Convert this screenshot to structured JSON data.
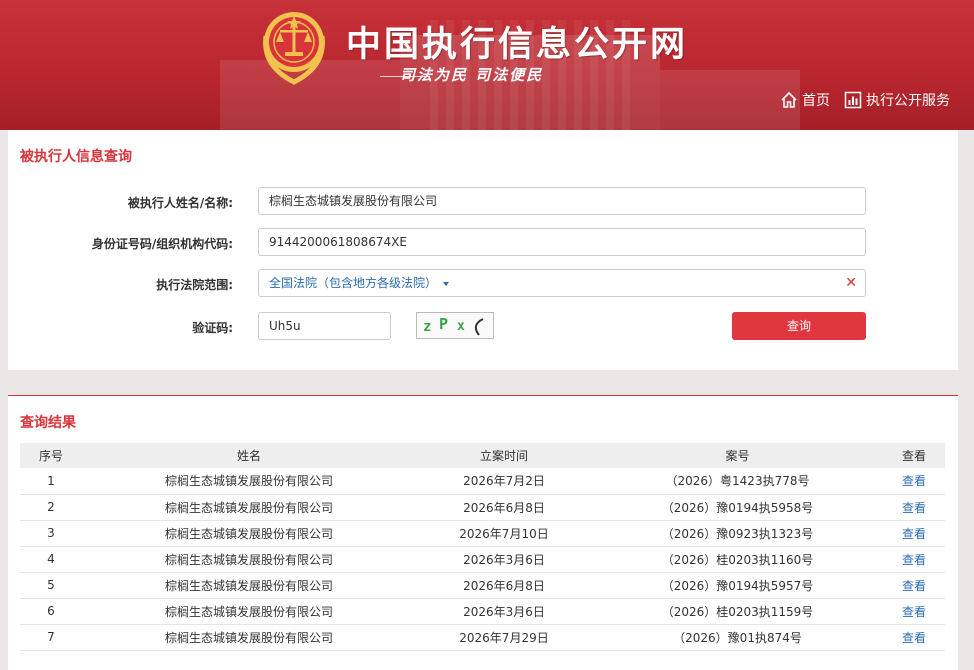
{
  "header": {
    "site_title": "中国执行信息公开网",
    "slogan": "司法为民  司法便民",
    "nav": [
      {
        "label": "首页",
        "icon": "home-icon"
      },
      {
        "label": "执行公开服务",
        "icon": "chart-icon"
      }
    ]
  },
  "search_panel": {
    "title": "被执行人信息查询",
    "fields": {
      "name": {
        "label": "被执行人姓名/名称:",
        "value": "棕榈生态城镇发展股份有限公司"
      },
      "id_code": {
        "label": "身份证号码/组织机构代码:",
        "value": "9144200061808674XE"
      },
      "court": {
        "label": "执行法院范围:",
        "value": "全国法院（包含地方各级法院）"
      },
      "captcha": {
        "label": "验证码:",
        "value": "Uh5u",
        "image_text": "zPxC"
      }
    },
    "query_button": "查询"
  },
  "results_panel": {
    "title": "查询结果",
    "columns": [
      "序号",
      "姓名",
      "立案时间",
      "案号",
      "查看"
    ],
    "rows": [
      {
        "no": "1",
        "name": "棕榈生态城镇发展股份有限公司",
        "date": "2026年7月2日",
        "case": "（2026）粤1423执778号",
        "view": "查看"
      },
      {
        "no": "2",
        "name": "棕榈生态城镇发展股份有限公司",
        "date": "2026年6月8日",
        "case": "（2026）豫0194执5958号",
        "view": "查看"
      },
      {
        "no": "3",
        "name": "棕榈生态城镇发展股份有限公司",
        "date": "2026年7月10日",
        "case": "（2026）豫0923执1323号",
        "view": "查看"
      },
      {
        "no": "4",
        "name": "棕榈生态城镇发展股份有限公司",
        "date": "2026年3月6日",
        "case": "（2026）桂0203执1160号",
        "view": "查看"
      },
      {
        "no": "5",
        "name": "棕榈生态城镇发展股份有限公司",
        "date": "2026年6月8日",
        "case": "（2026）豫0194执5957号",
        "view": "查看"
      },
      {
        "no": "6",
        "name": "棕榈生态城镇发展股份有限公司",
        "date": "2026年3月6日",
        "case": "（2026）桂0203执1159号",
        "view": "查看"
      },
      {
        "no": "7",
        "name": "棕榈生态城镇发展股份有限公司",
        "date": "2026年7月29日",
        "case": "（2026）豫01执874号",
        "view": "查看"
      }
    ]
  },
  "colors": {
    "brand_red": "#c8323a",
    "accent_red": "#d9343b",
    "link_blue": "#2b6cb0"
  }
}
